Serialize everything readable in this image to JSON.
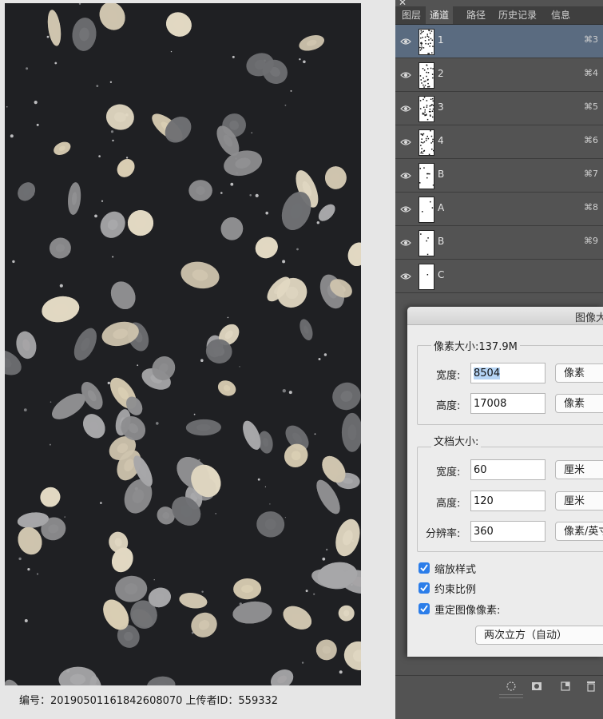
{
  "footer": {
    "info": "编号：20190501161842608070 上传者ID：559332"
  },
  "panel": {
    "close_glyph": "✕",
    "tabs": [
      {
        "label": "图层",
        "active": false
      },
      {
        "label": "通道",
        "active": true
      },
      {
        "label": "路径",
        "active": false
      },
      {
        "label": "历史记录",
        "active": false
      },
      {
        "label": "信息",
        "active": false
      }
    ],
    "channels": [
      {
        "name": "1",
        "shortcut": "⌘3",
        "selected": true
      },
      {
        "name": "2",
        "shortcut": "⌘4",
        "selected": false
      },
      {
        "name": "3",
        "shortcut": "⌘5",
        "selected": false
      },
      {
        "name": "4",
        "shortcut": "⌘6",
        "selected": false
      },
      {
        "name": "B",
        "shortcut": "⌘7",
        "selected": false
      },
      {
        "name": "A",
        "shortcut": "⌘8",
        "selected": false
      },
      {
        "name": "B",
        "shortcut": "⌘9",
        "selected": false
      },
      {
        "name": "C",
        "shortcut": "",
        "selected": false
      }
    ],
    "bottom_icons": [
      "load-selection-icon",
      "save-selection-icon",
      "new-channel-icon",
      "delete-channel-icon"
    ]
  },
  "dialog": {
    "title": "图像大小",
    "pixel_dimensions": {
      "label": "像素大小:137.9M",
      "width_label": "宽度:",
      "width_value": "8504",
      "width_unit": "像素",
      "height_label": "高度:",
      "height_value": "17008",
      "height_unit": "像素"
    },
    "document_size": {
      "label": "文档大小:",
      "width_label": "宽度:",
      "width_value": "60",
      "width_unit": "厘米",
      "height_label": "高度:",
      "height_value": "120",
      "height_unit": "厘米",
      "resolution_label": "分辨率:",
      "resolution_value": "360",
      "resolution_unit": "像素/英寸"
    },
    "options": [
      {
        "label": "缩放样式",
        "checked": true
      },
      {
        "label": "约束比例",
        "checked": true
      },
      {
        "label": "重定图像像素:",
        "checked": true
      }
    ],
    "resample_method": "两次立方（自动）"
  },
  "colors": {
    "panel_bg": "#535353",
    "selected_row": "#5a6b80",
    "texture_bg": "#1f2023",
    "checkbox": "#2b7de9"
  }
}
